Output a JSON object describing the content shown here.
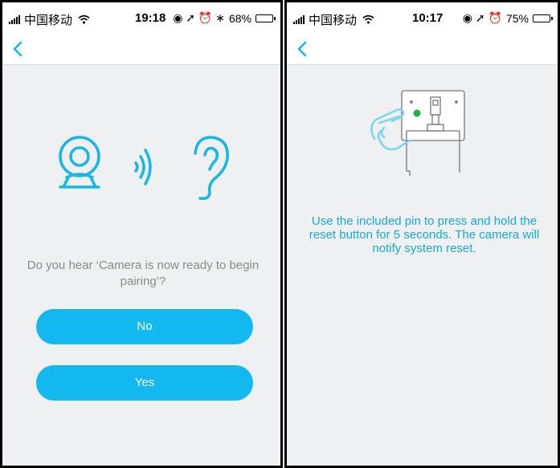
{
  "left_screen": {
    "status_bar": {
      "carrier": "中国移动",
      "time": "19:18",
      "indicators": "◉ ➚ ⏰ ∗",
      "battery": "68%",
      "battery_level": 0.68
    },
    "question": "Do you hear ‘Camera  is now ready to begin pairing’?",
    "buttons": {
      "no": "No",
      "yes": "Yes"
    }
  },
  "right_screen": {
    "status_bar": {
      "carrier": "中国移动",
      "time": "10:17",
      "indicators": "◉ ➚ ⏰",
      "battery": "75%",
      "battery_level": 0.75
    },
    "instruction": "Use the included pin to press and hold the reset button for 5 seconds. The camera will notify system reset."
  },
  "icons": {
    "back": "chevron-left-icon",
    "camera": "camera-icon",
    "sound": "sound-waves-icon",
    "ear": "ear-icon",
    "hand": "hand-icon",
    "device": "device-reset-icon"
  },
  "colors": {
    "accent": "#14b8f0",
    "instruction_text": "#16a8dc",
    "question_text": "#8a8a8a",
    "background": "#eff0f2",
    "reset_dot": "#22b14c"
  }
}
